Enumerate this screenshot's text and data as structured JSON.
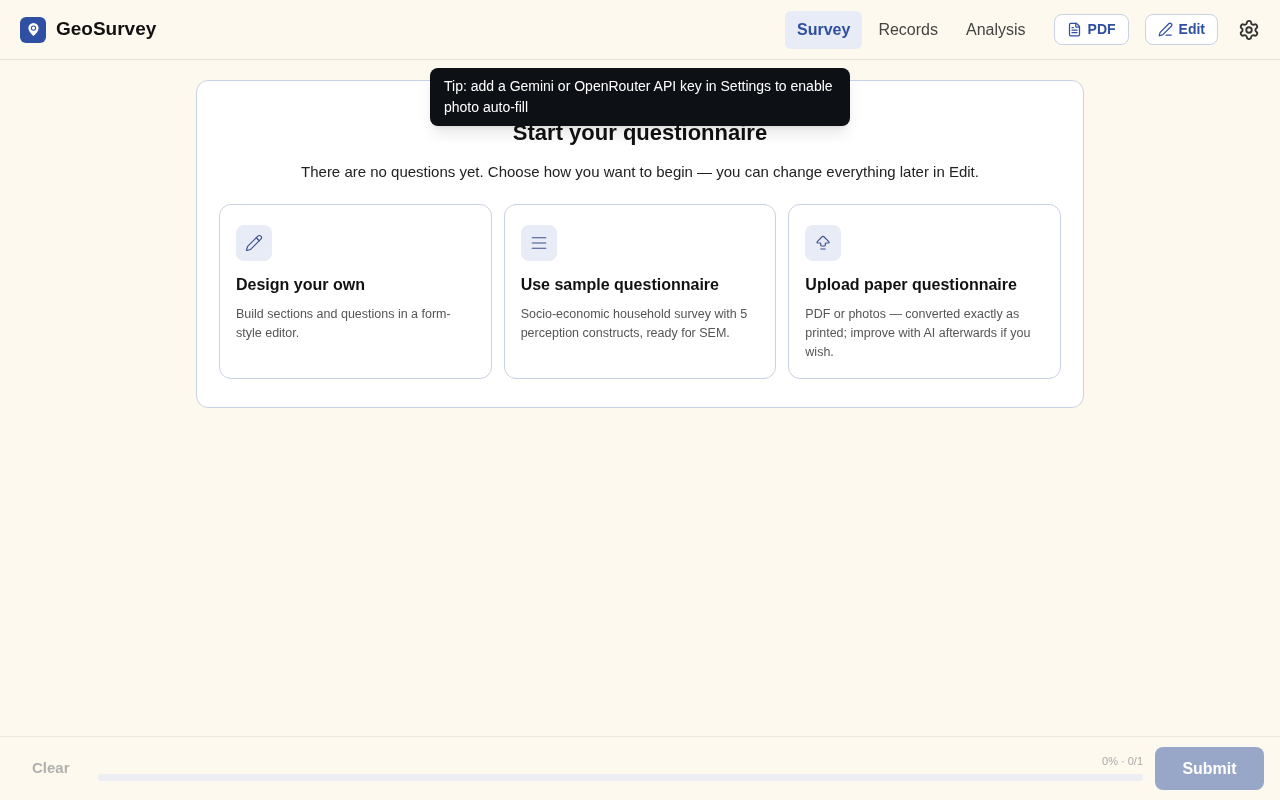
{
  "app": {
    "name": "GeoSurvey"
  },
  "tabs": [
    {
      "label": "Survey",
      "selected": true
    },
    {
      "label": "Records",
      "selected": false
    },
    {
      "label": "Analysis",
      "selected": false
    }
  ],
  "actions": [
    {
      "kind": "pdf",
      "label": "PDF"
    },
    {
      "kind": "edit",
      "label": "Edit"
    }
  ],
  "tooltip": "Tip: add a Gemini or OpenRouter API key in Settings to enable photo auto-fill",
  "start": {
    "title": "Start your questionnaire",
    "subtitle": "There are no questions yet. Choose how you want to begin — you can change everything later in Edit.",
    "options": [
      {
        "kind": "design",
        "title": "Design your own",
        "description": "Build sections and questions in a form-style editor."
      },
      {
        "kind": "sample",
        "title": "Use sample questionnaire",
        "description": "Socio-economic household survey with 5 perception constructs, ready for SEM."
      },
      {
        "kind": "upload",
        "title": "Upload paper questionnaire",
        "description": "PDF or photos — converted exactly as printed; improve with AI afterwards if you wish."
      }
    ]
  },
  "footer": {
    "clear": "Clear",
    "progress_text": "0% · 0/1",
    "level": 0,
    "submit": "Submit",
    "submit_disabled": true
  }
}
